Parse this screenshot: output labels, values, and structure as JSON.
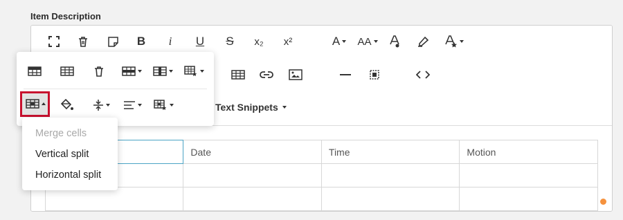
{
  "field": {
    "label": "Item Description"
  },
  "toolbar": {
    "italic_glyph": "i",
    "bold_glyph": "B",
    "underline_glyph": "U",
    "strike_glyph": "S",
    "subscript_glyph": "x₂",
    "superscript_glyph": "x²",
    "font_family_glyph": "A",
    "font_size_glyph": "AA",
    "text_snippets_label": "Text Snippets"
  },
  "table": {
    "headers": [
      "",
      "Date",
      "Time",
      "Motion"
    ]
  },
  "cell_menu": {
    "items": [
      {
        "label": "Merge cells",
        "enabled": false
      },
      {
        "label": "Vertical split",
        "enabled": true
      },
      {
        "label": "Horizontal split",
        "enabled": true
      }
    ]
  },
  "colors": {
    "highlight_border": "#c8102e",
    "active_cell_border": "#4aa3c4",
    "status_dot": "#f5923e"
  }
}
